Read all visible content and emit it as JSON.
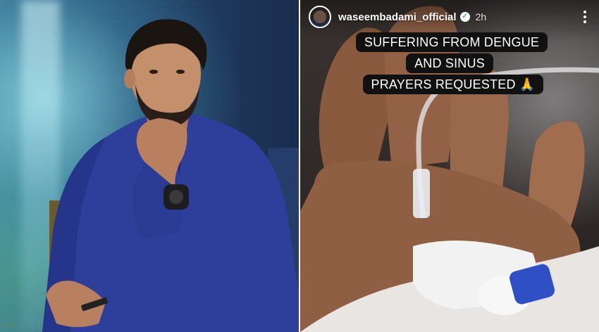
{
  "left_photo": {
    "alt": "man in blue kurta sitting with hand on chin"
  },
  "story": {
    "username": "waseembadami_official",
    "verified_mark": "✓",
    "time": "2h",
    "more_icon": "more-vertical-icon",
    "caption_lines": [
      "SUFFERING FROM DENGUE",
      "AND SINUS",
      "PRAYERS REQUESTED 🙏"
    ]
  },
  "colors": {
    "caption_bg": "#111111",
    "caption_text": "#ffffff",
    "kurta_blue": "#2d3f9a",
    "clamp_blue": "#2f4fc4"
  }
}
